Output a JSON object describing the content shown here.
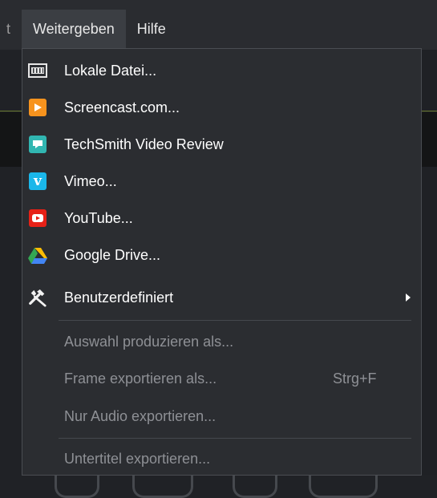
{
  "menubar": {
    "cut_item": "t",
    "items": [
      {
        "label": "Weitergeben"
      },
      {
        "label": "Hilfe"
      }
    ]
  },
  "dropdown": {
    "items": [
      {
        "label": "Lokale Datei...",
        "icon": "film-strip-icon"
      },
      {
        "label": "Screencast.com...",
        "icon": "screencast-icon",
        "color": "#f7931e"
      },
      {
        "label": "TechSmith Video Review",
        "icon": "techsmith-video-review-icon",
        "color": "#31b6b1"
      },
      {
        "label": "Vimeo...",
        "icon": "vimeo-icon",
        "color": "#1ab7ea"
      },
      {
        "label": "YouTube...",
        "icon": "youtube-icon",
        "color": "#e62117"
      },
      {
        "label": "Google Drive...",
        "icon": "google-drive-icon"
      },
      {
        "label": "Benutzerdefiniert",
        "icon": "tools-icon",
        "submenu": true
      }
    ],
    "disabled_items": [
      {
        "label": "Auswahl produzieren als..."
      },
      {
        "label": "Frame exportieren als...",
        "shortcut": "Strg+F"
      },
      {
        "label": "Nur Audio exportieren..."
      },
      {
        "label": "Untertitel exportieren..."
      }
    ]
  }
}
